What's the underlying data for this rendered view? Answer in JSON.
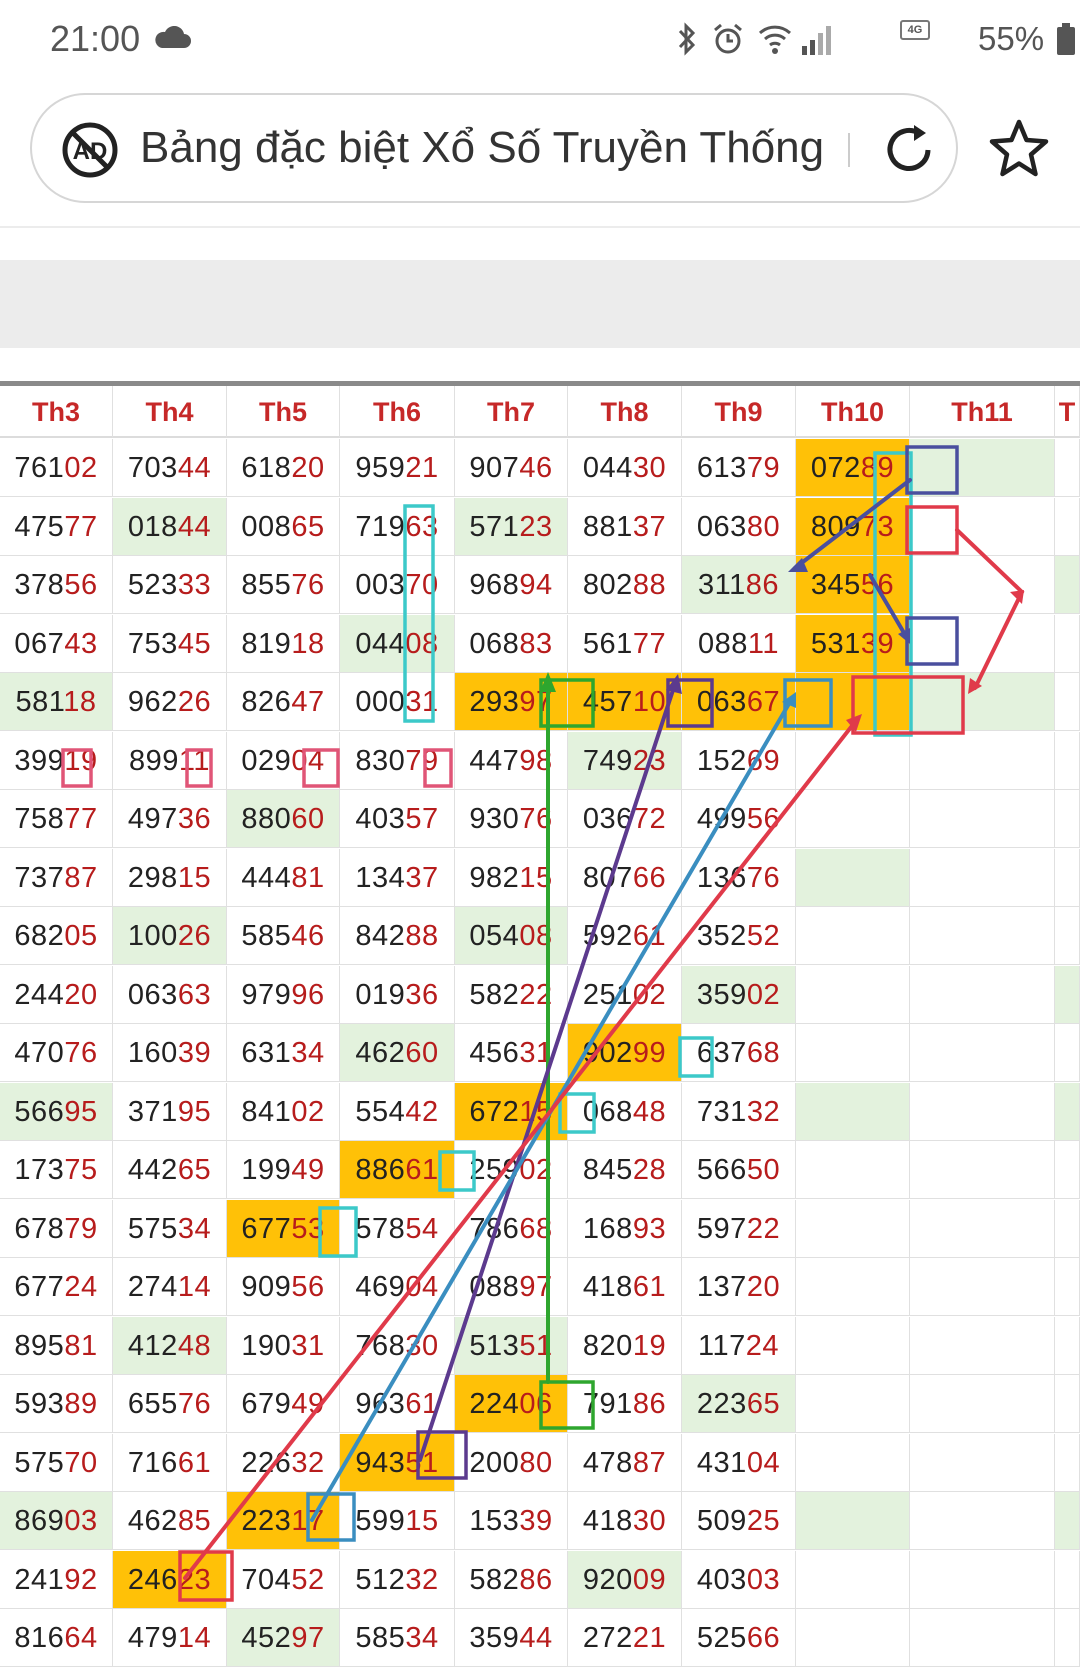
{
  "status": {
    "time": "21:00",
    "battery": "55%",
    "network_badge": "4G"
  },
  "browser": {
    "title": "Bảng đặc biệt Xổ Số Truyền Thống"
  },
  "columns": [
    "Th3",
    "Th4",
    "Th5",
    "Th6",
    "Th7",
    "Th8",
    "Th9",
    "Th10",
    "Th11",
    "T"
  ],
  "rows": [
    [
      "76102",
      "70344",
      "61820",
      "95921",
      "90746",
      "04430",
      "61379",
      "07289",
      "",
      ""
    ],
    [
      "47577",
      "01844",
      "00865",
      "71963",
      "57123",
      "88137",
      "06380",
      "80973",
      "",
      ""
    ],
    [
      "37856",
      "52333",
      "85576",
      "00370",
      "96894",
      "80288",
      "31186",
      "34556",
      "",
      ""
    ],
    [
      "06743",
      "75345",
      "81918",
      "04408",
      "06883",
      "56177",
      "08811",
      "53139",
      "",
      ""
    ],
    [
      "58118",
      "96226",
      "82647",
      "00031",
      "29397",
      "45710",
      "06367",
      "",
      "",
      ""
    ],
    [
      "39919",
      "89911",
      "02904",
      "83079",
      "44798",
      "74923",
      "15269",
      "",
      "",
      ""
    ],
    [
      "75877",
      "49736",
      "88060",
      "40357",
      "93076",
      "03672",
      "49956",
      "",
      "",
      ""
    ],
    [
      "73787",
      "29815",
      "44481",
      "13437",
      "98215",
      "80766",
      "13676",
      "",
      "",
      ""
    ],
    [
      "68205",
      "10026",
      "58546",
      "84288",
      "05408",
      "59261",
      "35252",
      "",
      "",
      ""
    ],
    [
      "24420",
      "06363",
      "97996",
      "01936",
      "58222",
      "25102",
      "35902",
      "",
      "",
      ""
    ],
    [
      "47076",
      "16039",
      "63134",
      "46260",
      "45631",
      "90299",
      "63768",
      "",
      "",
      ""
    ],
    [
      "56695",
      "37195",
      "84102",
      "55442",
      "67215",
      "06848",
      "73132",
      "",
      "",
      ""
    ],
    [
      "17375",
      "44265",
      "19949",
      "88661",
      "25902",
      "84528",
      "56650",
      "",
      "",
      ""
    ],
    [
      "67879",
      "57534",
      "67753",
      "57854",
      "78668",
      "16893",
      "59722",
      "",
      "",
      ""
    ],
    [
      "67724",
      "27414",
      "90956",
      "46904",
      "08897",
      "41861",
      "13720",
      "",
      "",
      ""
    ],
    [
      "89581",
      "41248",
      "19031",
      "76830",
      "51351",
      "82019",
      "11724",
      "",
      "",
      ""
    ],
    [
      "59389",
      "65576",
      "67949",
      "96361",
      "22406",
      "79186",
      "22365",
      "",
      "",
      ""
    ],
    [
      "57570",
      "71661",
      "22632",
      "94351",
      "20080",
      "47887",
      "43104",
      "",
      "",
      ""
    ],
    [
      "86903",
      "46285",
      "22317",
      "59915",
      "15339",
      "41830",
      "50925",
      "",
      "",
      ""
    ],
    [
      "24192",
      "24623",
      "70452",
      "51232",
      "58286",
      "92009",
      "40303",
      "",
      "",
      ""
    ],
    [
      "81664",
      "47914",
      "45297",
      "58534",
      "35944",
      "27221",
      "52566",
      "",
      "",
      ""
    ]
  ],
  "highlights": {
    "orange": [
      [
        0,
        7
      ],
      [
        1,
        7
      ],
      [
        2,
        7
      ],
      [
        3,
        7
      ],
      [
        4,
        4
      ],
      [
        4,
        5
      ],
      [
        4,
        6
      ],
      [
        4,
        7
      ],
      [
        10,
        5
      ],
      [
        11,
        4
      ],
      [
        12,
        3
      ],
      [
        13,
        2
      ],
      [
        16,
        4
      ],
      [
        17,
        3
      ],
      [
        18,
        2
      ],
      [
        19,
        1
      ]
    ],
    "green": [
      [
        0,
        8
      ],
      [
        1,
        1
      ],
      [
        1,
        4
      ],
      [
        2,
        6
      ],
      [
        2,
        9
      ],
      [
        3,
        3
      ],
      [
        4,
        0
      ],
      [
        4,
        8
      ],
      [
        5,
        5
      ],
      [
        6,
        2
      ],
      [
        7,
        7
      ],
      [
        8,
        1
      ],
      [
        8,
        4
      ],
      [
        9,
        6
      ],
      [
        9,
        9
      ],
      [
        10,
        3
      ],
      [
        11,
        0
      ],
      [
        11,
        7
      ],
      [
        11,
        9
      ],
      [
        15,
        1
      ],
      [
        15,
        4
      ],
      [
        16,
        6
      ],
      [
        18,
        0
      ],
      [
        18,
        7
      ],
      [
        18,
        9
      ],
      [
        19,
        5
      ],
      [
        20,
        2
      ]
    ]
  },
  "colors": {
    "accent_red": "#c62828",
    "highlight_orange": "#ffc107",
    "highlight_green": "#e3f2dd"
  }
}
